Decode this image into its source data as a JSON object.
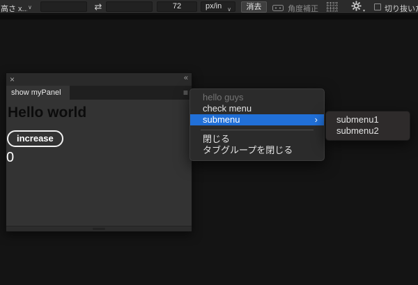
{
  "toolbar": {
    "aspect_dropdown_label": "高さ x...",
    "width_value": "",
    "height_value": "",
    "resolution_value": "72",
    "unit_dropdown_value": "px/in",
    "clear_button_label": "消去",
    "straighten_label": "角度補正",
    "crop_checkbox_label": "切り抜いた",
    "crop_checkbox_checked": false
  },
  "icons": {
    "swap": "⇄",
    "chevron_down": "∨",
    "close": "×",
    "collapse": "«",
    "panel_menu": "≡",
    "submenu_arrow": "›",
    "gear_dropdown": "▾"
  },
  "panel": {
    "tab_label": "show myPanel",
    "heading": "Hello world",
    "increase_button_label": "increase",
    "counter_value": "0"
  },
  "context_menu": {
    "items": [
      {
        "label": "hello guys",
        "state": "disabled"
      },
      {
        "label": "check menu",
        "state": "normal"
      },
      {
        "label": "submenu",
        "state": "highlighted",
        "has_submenu": true
      },
      {
        "label": "閉じる",
        "state": "normal"
      },
      {
        "label": "タブグループを閉じる",
        "state": "normal"
      }
    ],
    "submenu_items": [
      {
        "label": "submenu1"
      },
      {
        "label": "submenu2"
      }
    ],
    "highlight_color": "#2170d8"
  }
}
